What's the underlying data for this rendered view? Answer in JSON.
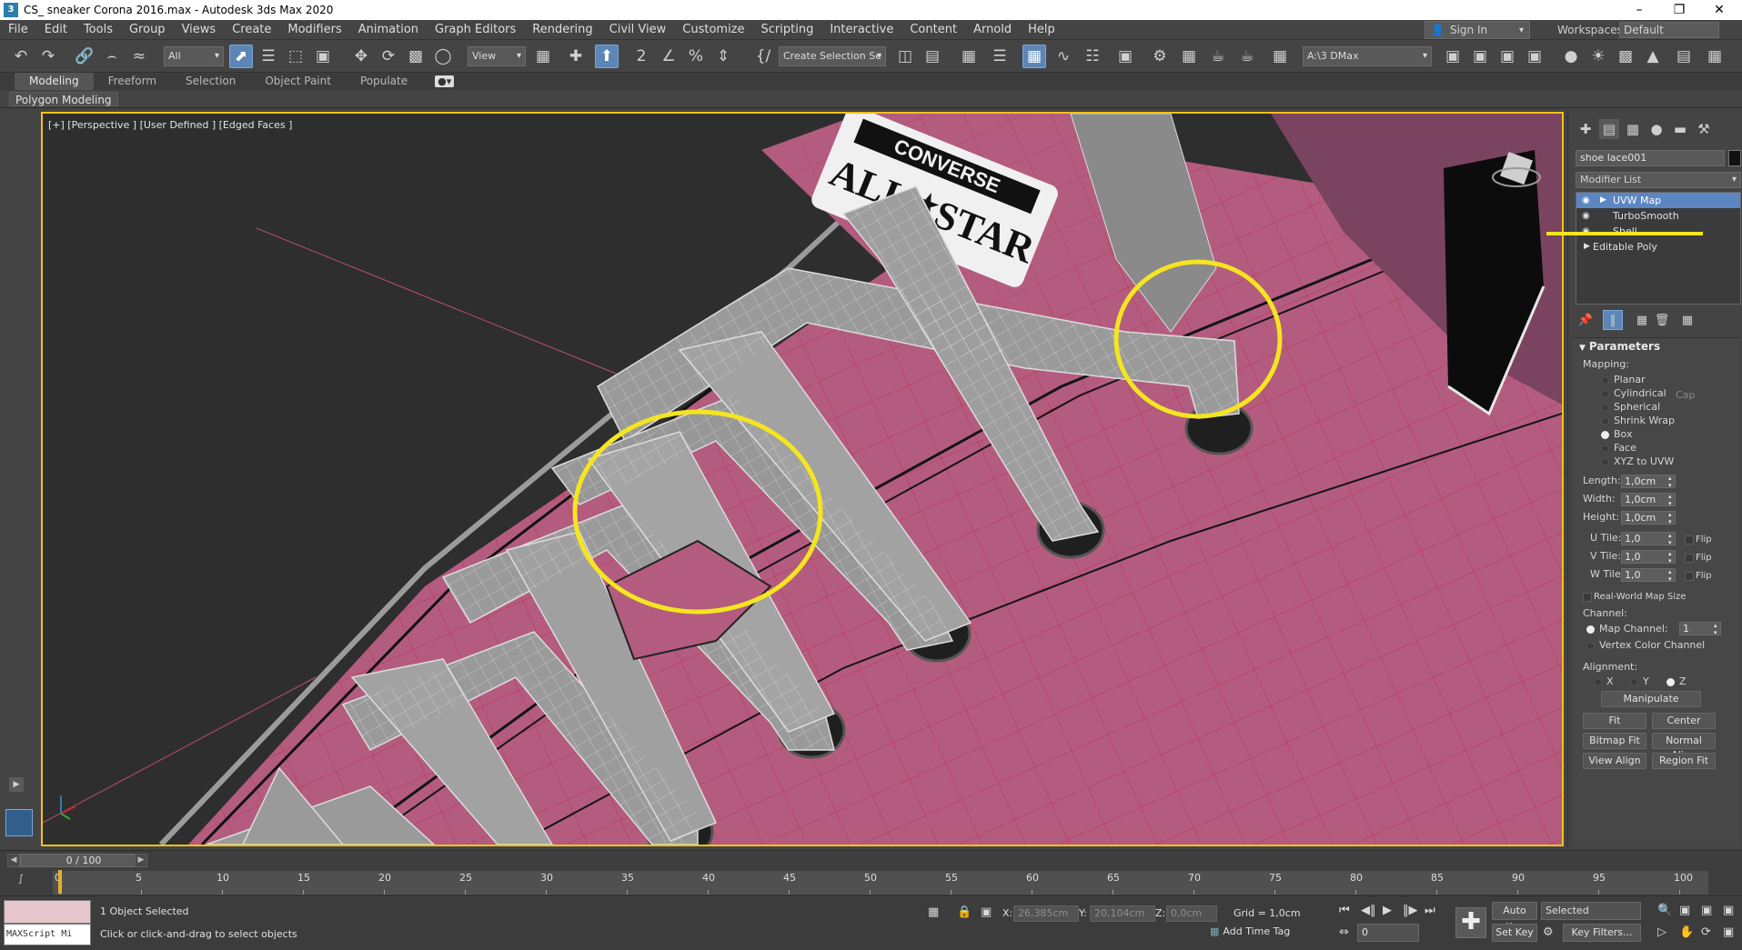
{
  "window": {
    "title": "CS_ sneaker Corona 2016.max - Autodesk 3ds Max 2020",
    "app_icon": "3"
  },
  "menu": [
    "File",
    "Edit",
    "Tools",
    "Group",
    "Views",
    "Create",
    "Modifiers",
    "Animation",
    "Graph Editors",
    "Rendering",
    "Civil View",
    "Customize",
    "Scripting",
    "Interactive",
    "Content",
    "Arnold",
    "Help"
  ],
  "account": {
    "sign_in": "Sign In",
    "workspaces_label": "Workspaces:",
    "workspace": "Default"
  },
  "toolbar": {
    "selection_filter": "All",
    "ref_coord": "View",
    "snap_label": "2",
    "named_selection": "Create Selection Se",
    "project_path": "A:\\3 DMax"
  },
  "ribbon": {
    "tabs": [
      "Modeling",
      "Freeform",
      "Selection",
      "Object Paint",
      "Populate"
    ],
    "active_tab": "Modeling",
    "panel_label": "Polygon Modeling"
  },
  "viewport": {
    "label": "[+] [Perspective ] [User Defined ] [Edged Faces ]",
    "tag_line1": "CONVERSE",
    "tag_line2": "ALL",
    "tag_line3": "STAR",
    "shoe_color": "#b35c80",
    "wire_color": "#d91e3c",
    "lace_color": "#9a9a9a",
    "highlight_color": "#f4e520"
  },
  "command_panel": {
    "object_name": "shoe lace001",
    "modifier_list": "Modifier List",
    "stack": [
      {
        "name": "UVW Map",
        "selected": true,
        "expandable": true
      },
      {
        "name": "TurboSmooth",
        "selected": false,
        "expandable": false
      },
      {
        "name": "Shell",
        "selected": false,
        "expandable": false
      },
      {
        "name": "Editable Poly",
        "selected": false,
        "expandable": true
      }
    ],
    "rollout_title": "Parameters",
    "mapping_label": "Mapping:",
    "mapping": [
      "Planar",
      "Cylindrical",
      "Spherical",
      "Shrink Wrap",
      "Box",
      "Face",
      "XYZ to UVW"
    ],
    "mapping_selected": "Box",
    "cap_label": "Cap",
    "length_label": "Length:",
    "length": "1,0cm",
    "width_label": "Width:",
    "width": "1,0cm",
    "height_label": "Height:",
    "height": "1,0cm",
    "utile_label": "U Tile:",
    "utile": "1,0",
    "vtile_label": "V Tile:",
    "vtile": "1,0",
    "wtile_label": "W Tile:",
    "wtile": "1,0",
    "flip_label": "Flip",
    "real_world": "Real-World Map Size",
    "channel_label": "Channel:",
    "map_channel_label": "Map Channel:",
    "map_channel": "1",
    "vertex_color": "Vertex Color Channel",
    "alignment_label": "Alignment:",
    "axes": [
      "X",
      "Y",
      "Z"
    ],
    "axis_selected": "Z",
    "buttons": {
      "manipulate": "Manipulate",
      "fit": "Fit",
      "center": "Center",
      "bitmap_fit": "Bitmap Fit",
      "normal_align": "Normal Align",
      "view_align": "View Align",
      "region_fit": "Region Fit"
    }
  },
  "timeline": {
    "frame": "0 / 100",
    "ticks": [
      "0",
      "5",
      "10",
      "15",
      "20",
      "25",
      "30",
      "35",
      "40",
      "45",
      "50",
      "55",
      "60",
      "65",
      "70",
      "75",
      "80",
      "85",
      "90",
      "95",
      "100"
    ]
  },
  "status": {
    "maxscript": "MAXScript Mi",
    "selected": "1 Object Selected",
    "prompt": "Click or click-and-drag to select objects",
    "x_label": "X:",
    "x": "26,385cm",
    "y_label": "Y:",
    "y": "20,104cm",
    "z_label": "Z:",
    "z": "0,0cm",
    "grid": "Grid = 1,0cm",
    "add_time_tag": "Add Time Tag",
    "auto_key": "Auto Key",
    "set_key": "Set Key",
    "key_mode": "Selected",
    "key_filters": "Key Filters...",
    "current_frame": "0"
  }
}
